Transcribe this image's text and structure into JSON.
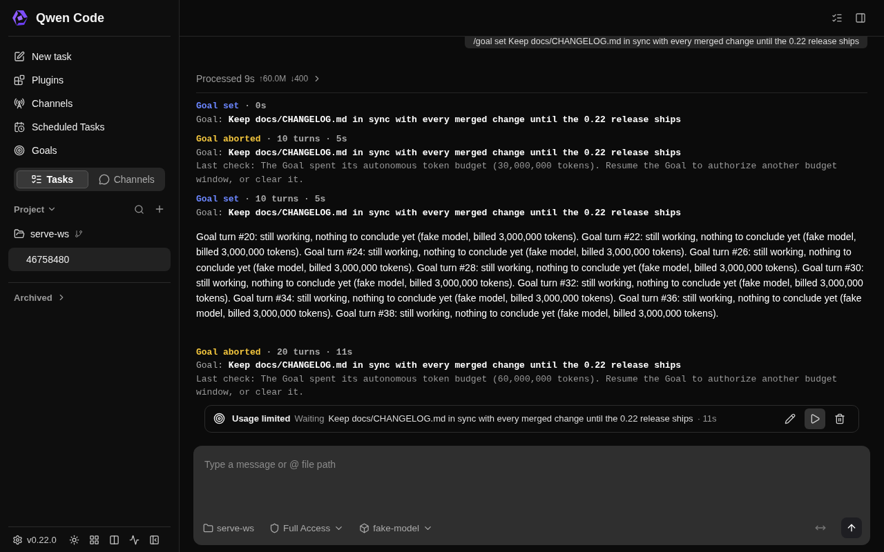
{
  "app": {
    "name": "Qwen Code"
  },
  "nav": [
    {
      "label": "New task"
    },
    {
      "label": "Plugins"
    },
    {
      "label": "Channels"
    },
    {
      "label": "Scheduled Tasks"
    },
    {
      "label": "Goals"
    }
  ],
  "view_tabs": [
    {
      "label": "Tasks",
      "selected": true
    },
    {
      "label": "Channels",
      "selected": false
    }
  ],
  "project": {
    "label": "Project",
    "folder": "serve-ws",
    "tasks": [
      {
        "label": "46758480",
        "selected": true
      }
    ]
  },
  "archived": "Archived",
  "footer": {
    "version": "v0.22.0"
  },
  "user_message": "/goal set Keep docs/CHANGELOG.md in sync with every merged change until the 0.22 release ships",
  "processed": {
    "label": "Processed 9s",
    "tokens_up": "↑60.0M",
    "tokens_down": "↓400"
  },
  "events": [
    {
      "kind": "goal_set",
      "label": "Goal set",
      "meta": "· 0s",
      "goal_prefix": "Goal:",
      "goal": "Keep docs/CHANGELOG.md in sync with every merged change until the 0.22 release ships"
    },
    {
      "kind": "goal_aborted",
      "label": "Goal aborted",
      "meta": "· 10 turns · 5s",
      "goal_prefix": "Goal:",
      "goal": "Keep docs/CHANGELOG.md in sync with every merged change until the 0.22 release ships",
      "last_check": "Last check: The Goal spent its autonomous token budget (30,000,000 tokens). Resume the Goal to authorize another budget window, or clear it."
    },
    {
      "kind": "goal_set",
      "label": "Goal set",
      "meta": "· 10 turns · 5s",
      "goal_prefix": "Goal:",
      "goal": "Keep docs/CHANGELOG.md in sync with every merged change until the 0.22 release ships"
    },
    {
      "kind": "text",
      "text": "Goal turn #20: still working, nothing to conclude yet (fake model, billed 3,000,000 tokens). Goal turn #22: still working, nothing to conclude yet (fake model, billed 3,000,000 tokens). Goal turn #24: still working, nothing to conclude yet (fake model, billed 3,000,000 tokens). Goal turn #26: still working, nothing to conclude yet (fake model, billed 3,000,000 tokens). Goal turn #28: still working, nothing to conclude yet (fake model, billed 3,000,000 tokens). Goal turn #30: still working, nothing to conclude yet (fake model, billed 3,000,000 tokens). Goal turn #32: still working, nothing to conclude yet (fake model, billed 3,000,000 tokens). Goal turn #34: still working, nothing to conclude yet (fake model, billed 3,000,000 tokens). Goal turn #36: still working, nothing to conclude yet (fake model, billed 3,000,000 tokens). Goal turn #38: still working, nothing to conclude yet (fake model, billed 3,000,000 tokens)."
    },
    {
      "kind": "goal_aborted",
      "label": "Goal aborted",
      "meta": "· 20 turns · 11s",
      "goal_prefix": "Goal:",
      "goal": "Keep docs/CHANGELOG.md in sync with every merged change until the 0.22 release ships",
      "last_check": "Last check: The Goal spent its autonomous token budget (60,000,000 tokens). Resume the Goal to authorize another budget window, or clear it."
    }
  ],
  "goal_bar": {
    "title": "Usage limited",
    "state": "Waiting",
    "goal": "Keep docs/CHANGELOG.md in sync with every merged change until the 0.22 release ships",
    "elapsed": "· 11s"
  },
  "composer": {
    "placeholder": "Type a message or @ file path",
    "folder": "serve-ws",
    "access": "Full Access",
    "model": "fake-model"
  }
}
